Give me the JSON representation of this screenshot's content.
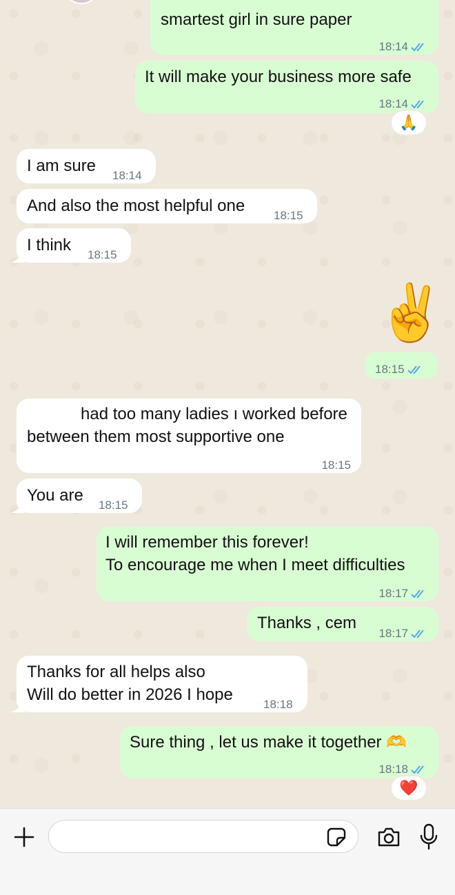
{
  "messages": [
    {
      "id": "m1",
      "dir": "out",
      "text": "smartest girl in sure paper",
      "time": "18:14",
      "ticks": "read"
    },
    {
      "id": "m2",
      "dir": "out",
      "text": "It will make your business more safe",
      "time": "18:14",
      "ticks": "read",
      "reaction": "🙏"
    },
    {
      "id": "m3",
      "dir": "in",
      "text": "I am sure",
      "time": "18:14"
    },
    {
      "id": "m4",
      "dir": "in",
      "text": "And also the most helpful one",
      "time": "18:15"
    },
    {
      "id": "m5",
      "dir": "in",
      "text": "I think",
      "time": "18:15"
    },
    {
      "id": "m6",
      "dir": "out",
      "emoji": "✌️",
      "time": "18:15",
      "ticks": "read"
    },
    {
      "id": "m7",
      "dir": "in",
      "text": "had too many ladies ı worked before\nbetween them most supportive one",
      "time": "18:15"
    },
    {
      "id": "m8",
      "dir": "in",
      "text": "You are",
      "time": "18:15"
    },
    {
      "id": "m9",
      "dir": "out",
      "text": "I will remember this forever!\nTo encourage me when I meet difficulties",
      "time": "18:17",
      "ticks": "read"
    },
    {
      "id": "m10",
      "dir": "out",
      "text": "Thanks , cem",
      "time": "18:17",
      "ticks": "read"
    },
    {
      "id": "m11",
      "dir": "in",
      "text": "Thanks for all helps also\nWill do better in 2026 I hope",
      "time": "18:18"
    },
    {
      "id": "m12",
      "dir": "out",
      "text": "Sure thing , let us make it together 🫶",
      "time": "18:18",
      "ticks": "read",
      "reaction": "❤️"
    }
  ],
  "composer": {
    "input_value": "",
    "icons": [
      "plus-icon",
      "sticker-icon",
      "camera-icon",
      "microphone-icon"
    ]
  },
  "colors": {
    "outgoing_bubble": "#d9fdd3",
    "incoming_bubble": "#ffffff",
    "read_ticks": "#53a6ef",
    "timestamp": "#667781",
    "wallpaper": "#efe8dd"
  }
}
